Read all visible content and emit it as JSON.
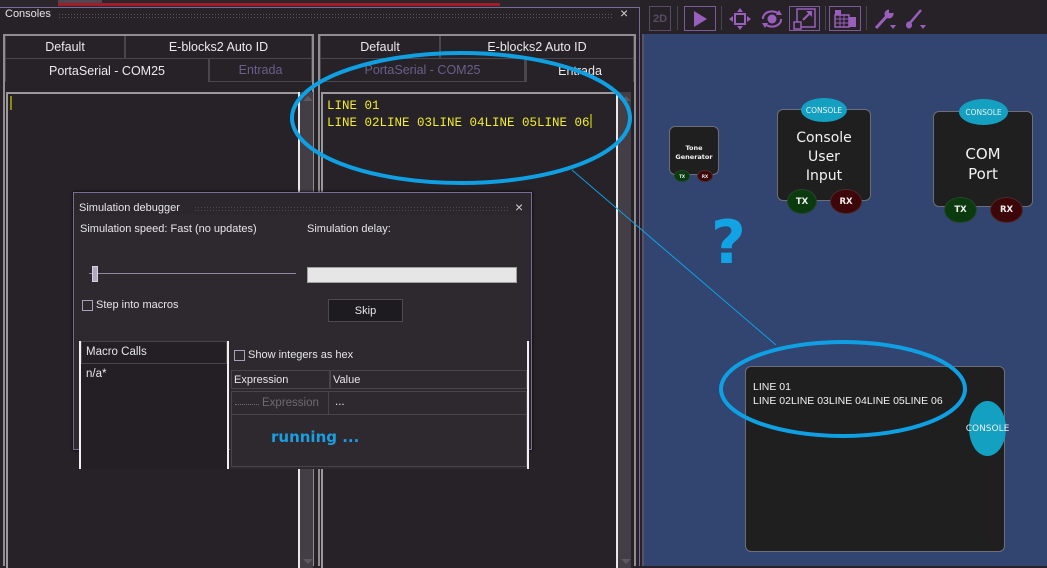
{
  "consoles_panel": {
    "title": "Consoles",
    "close_glyph": "×",
    "left_pane": {
      "tabs_row1": [
        "Default",
        "E-blocks2 Auto ID"
      ],
      "tabs_row2": [
        "PortaSerial - COM25",
        "Entrada"
      ],
      "active_tab": "PortaSerial - COM25",
      "output": ""
    },
    "right_pane": {
      "tabs_row1": [
        "Default",
        "E-blocks2 Auto ID"
      ],
      "tabs_row2": [
        "PortaSerial - COM25",
        "Entrada"
      ],
      "active_tab": "Entrada",
      "output_lines": [
        "LINE 01",
        "LINE 02LINE 03LINE 04LINE 05LINE 06"
      ]
    },
    "text_color": "#f2ee2a"
  },
  "simulation_debugger": {
    "title": "Simulation debugger",
    "close_glyph": "×",
    "speed_label": "Simulation speed: Fast (no updates)",
    "speed_slider_value": 0.03,
    "delay_label": "Simulation delay:",
    "delay_value": "",
    "step_into_macros_label": "Step into macros",
    "step_into_macros_checked": false,
    "skip_label": "Skip",
    "macro_calls": {
      "header": "Macro Calls",
      "rows": [
        "n/a*"
      ]
    },
    "watch": {
      "show_hex_label": "Show integers as hex",
      "show_hex_checked": false,
      "columns": [
        "Expression",
        "Value"
      ],
      "rows": [
        {
          "expression": "Expression",
          "value": "..."
        }
      ]
    },
    "status": "running ..."
  },
  "toolbar": {
    "buttons": [
      {
        "name": "2d-view",
        "label": "2D",
        "icon": "2d-icon"
      },
      {
        "name": "select",
        "icon": "pointer-icon"
      },
      {
        "name": "move",
        "icon": "move-icon"
      },
      {
        "name": "rotate",
        "icon": "rotate-icon"
      },
      {
        "name": "scale",
        "icon": "scale-icon"
      },
      {
        "name": "panel-grid",
        "icon": "grid-icon"
      },
      {
        "name": "tools",
        "icon": "wrench-icon"
      },
      {
        "name": "paint",
        "icon": "brush-icon"
      }
    ],
    "accent": "#9a5fbd"
  },
  "canvas": {
    "background": "#314570",
    "components": [
      {
        "id": "tone-generator",
        "title": "Tone Generator",
        "ports": [
          "TX",
          "RX"
        ]
      },
      {
        "id": "console-user-input",
        "title_lines": [
          "Console",
          "User",
          "Input"
        ],
        "badge": "CONSOLE",
        "ports": [
          "TX",
          "RX"
        ]
      },
      {
        "id": "com-port",
        "title_lines": [
          "COM",
          "Port"
        ],
        "badge": "CONSOLE",
        "ports": [
          "TX",
          "RX"
        ]
      },
      {
        "id": "console-display",
        "badge": "CONSOLE",
        "text_lines": [
          "LINE 01",
          "LINE 02LINE 03LINE 04LINE 05LINE 06"
        ]
      }
    ],
    "annotation": "?"
  }
}
